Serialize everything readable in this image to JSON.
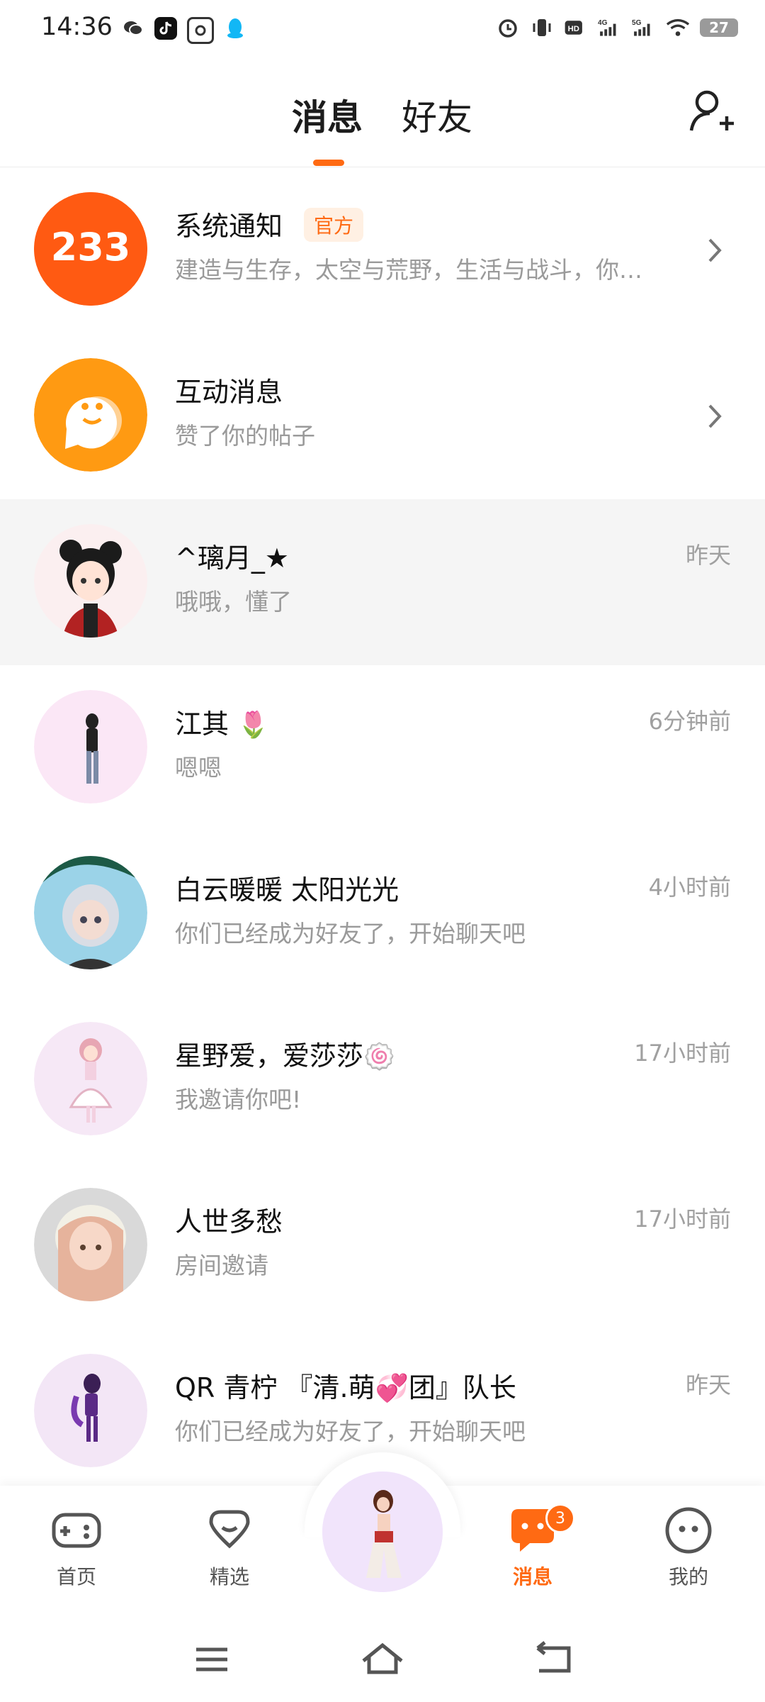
{
  "status_bar": {
    "time": "14:36",
    "battery": "27",
    "net1": "4G",
    "net2": "5G",
    "hd": "HD"
  },
  "header": {
    "tab_messages": "消息",
    "tab_friends": "好友",
    "accent_color": "#ff6a13"
  },
  "conversations": [
    {
      "name": "系统通知",
      "badge": "官方",
      "preview": "建造与生存，太空与荒野，生活与战斗，你…",
      "time": ""
    },
    {
      "name": "互动消息",
      "preview": "赞了你的帖子",
      "time": ""
    },
    {
      "name": "^璃月_★",
      "preview": "哦哦，懂了",
      "time": "昨天"
    },
    {
      "name": "江其",
      "emoji": "🌷",
      "preview": "嗯嗯",
      "time": "6分钟前"
    },
    {
      "name": "白云暖暖 太阳光光",
      "preview": "你们已经成为好友了，开始聊天吧",
      "time": "4小时前"
    },
    {
      "name": "星野爱，爱莎莎",
      "emoji": "🍥",
      "preview": "我邀请你吧!",
      "time": "17小时前"
    },
    {
      "name": "人世多愁",
      "preview": "房间邀请",
      "time": "17小时前"
    },
    {
      "name": "QR 青柠 『清.萌💞团』队长",
      "preview": "你们已经成为好友了，开始聊天吧",
      "time": "昨天"
    }
  ],
  "system_avatar_text": "233",
  "bottom_nav": {
    "home": "首页",
    "featured": "精选",
    "messages": "消息",
    "messages_count": "3",
    "me": "我的"
  }
}
